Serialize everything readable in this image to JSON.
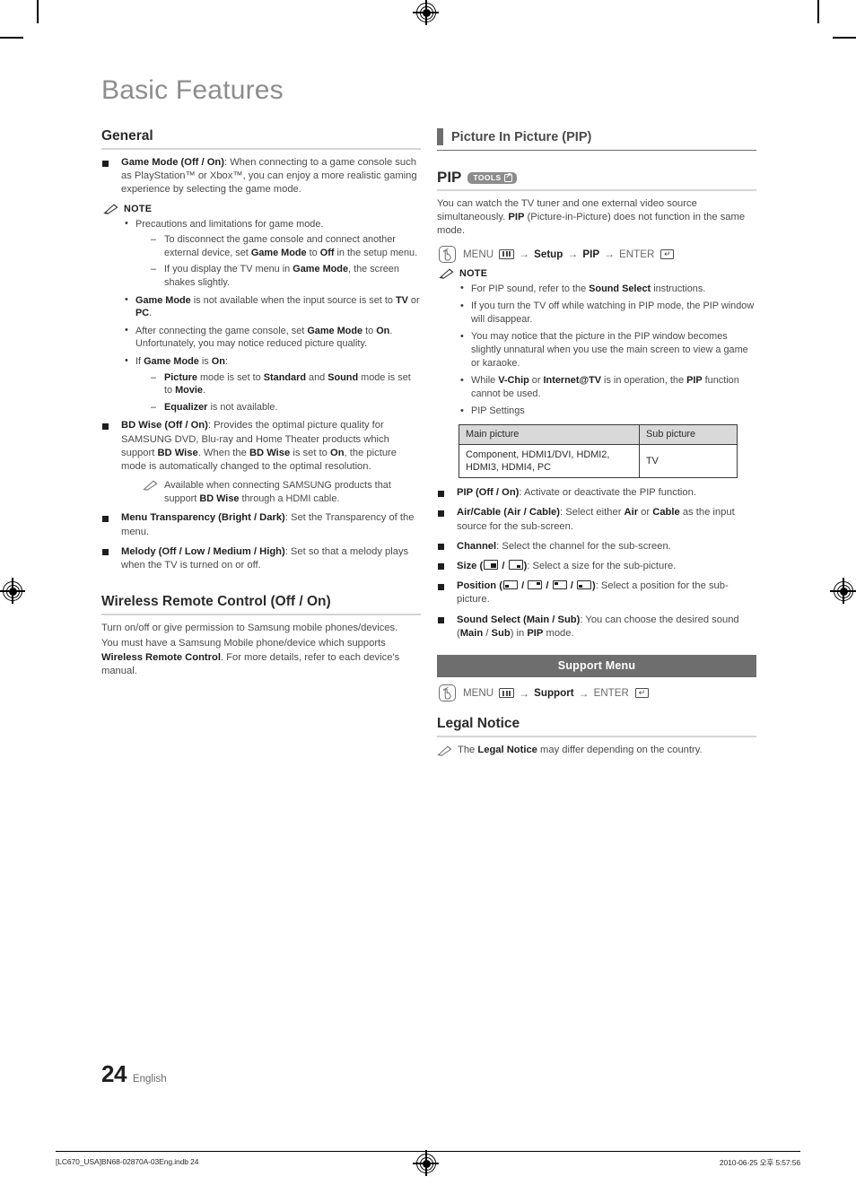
{
  "document": {
    "title": "Basic Features",
    "page_number": "24",
    "language": "English",
    "footer_left": "[LC670_USA]BN68-02870A-03Eng.indb   24",
    "footer_right": "2010-06-25   오후 5:57:56"
  },
  "left_column": {
    "general": {
      "heading": "General",
      "items": [
        {
          "label": "Game Mode (Off / On)",
          "text": ": When connecting to a game console such as PlayStation™ or Xbox™, you can enjoy a more realistic gaming experience by selecting the game mode."
        }
      ],
      "note_label": "NOTE",
      "notes": [
        {
          "text": "Precautions and limitations for game mode.",
          "sub": [
            "To disconnect the game console and connect another external device, set <b>Game Mode</b> to <b>Off</b> in the setup menu.",
            "If you display the TV menu in <b>Game Mode</b>, the screen shakes slightly."
          ]
        },
        {
          "text": "<b>Game Mode</b> is not available when the input source is set to <b>TV</b> or <b>PC</b>."
        },
        {
          "text": "After connecting the game console, set <b>Game Mode</b> to <b>On</b>. Unfortunately, you may notice reduced picture quality."
        },
        {
          "text": "If <b>Game Mode</b> is <b>On</b>:",
          "sub": [
            "<b>Picture</b> mode is set to <b>Standard</b> and <b>Sound</b> mode is set to <b>Movie</b>.",
            "<b>Equalizer</b> is not available."
          ]
        }
      ],
      "bd_wise": {
        "label": "BD Wise (Off / On)",
        "text": ": Provides the optimal picture quality for SAMSUNG DVD, Blu-ray and Home Theater products which support <b>BD Wise</b>. When the <b>BD Wise</b> is set to <b>On</b>, the picture mode is automatically changed to the optimal resolution.",
        "sub_note": "Available when connecting SAMSUNG products that support <b>BD Wise</b> through a HDMI cable."
      },
      "menu_transparency": {
        "label": "Menu Transparency (Bright / Dark)",
        "text": ": Set the Transparency of the menu."
      },
      "melody": {
        "label": "Melody (Off / Low / Medium / High)",
        "text": ": Set so that a melody plays when the TV is turned on or off."
      }
    },
    "wireless_remote": {
      "heading": "Wireless Remote Control (Off / On)",
      "paragraph_1": "Turn on/off or give permission to Samsung mobile phones/devices.",
      "paragraph_2": "You must have a Samsung Mobile phone/device which supports <b>Wireless Remote Control</b>. For more details, refer to each device's manual."
    }
  },
  "right_column": {
    "section_heading": "Picture In Picture (PIP)",
    "pip": {
      "heading": "PIP",
      "tools_badge": "TOOLS",
      "intro": "You can watch the TV tuner and one external video source simultaneously. <b>PIP</b> (Picture-in-Picture) does not function in the same mode.",
      "menu_path": [
        "MENU",
        "Setup",
        "PIP",
        "ENTER"
      ],
      "note_label": "NOTE",
      "notes": [
        "For PIP sound, refer to the <b>Sound Select</b> instructions.",
        "If you turn the TV off while watching in PIP mode, the PIP window will disappear.",
        "You may notice that the picture in the PIP window becomes slightly unnatural when you use the main screen to view a game or karaoke.",
        "While <b>V-Chip</b> or <b>Internet@TV</b> is in operation, the <b>PIP</b> function cannot be used.",
        "PIP Settings"
      ],
      "table": {
        "headers": [
          "Main picture",
          "Sub picture"
        ],
        "rows": [
          [
            "Component, HDMI1/DVI, HDMI2, HDMI3, HDMI4, PC",
            "TV"
          ]
        ]
      },
      "settings": [
        {
          "label": "PIP (Off / On)",
          "text": ": Activate or deactivate the PIP function."
        },
        {
          "label": "Air/Cable (Air / Cable)",
          "text": ": Select either <b>Air</b> or <b>Cable</b> as the input source for the sub-screen."
        },
        {
          "label": "Channel",
          "text": ": Select the channel for the sub-screen."
        },
        {
          "label": "Size",
          "icons": [
            "size-large-icon",
            "size-small-icon"
          ],
          "text": ": Select a size for the sub-picture."
        },
        {
          "label": "Position",
          "icons": [
            "position-bottom-left-icon",
            "position-top-right-icon",
            "position-top-left-icon",
            "position-bottom-left-2-icon"
          ],
          "text": ": Select a position for the sub-picture."
        },
        {
          "label": "Sound Select (Main / Sub)",
          "text": ": You can choose the desired sound (<b>Main</b> / <b>Sub</b>) in <b>PIP</b> mode."
        }
      ]
    },
    "support_menu": {
      "banner": "Support Menu",
      "menu_path": [
        "MENU",
        "Support",
        "ENTER"
      ]
    },
    "legal_notice": {
      "heading": "Legal Notice",
      "note": "The <b>Legal Notice</b> may differ depending on the country."
    }
  },
  "colors": {
    "banner_gray": "#6e6e6e",
    "table_header_gray": "#d9d9d9",
    "rule_gray": "#d5d5d5",
    "title_gray": "#8d8d8d"
  }
}
